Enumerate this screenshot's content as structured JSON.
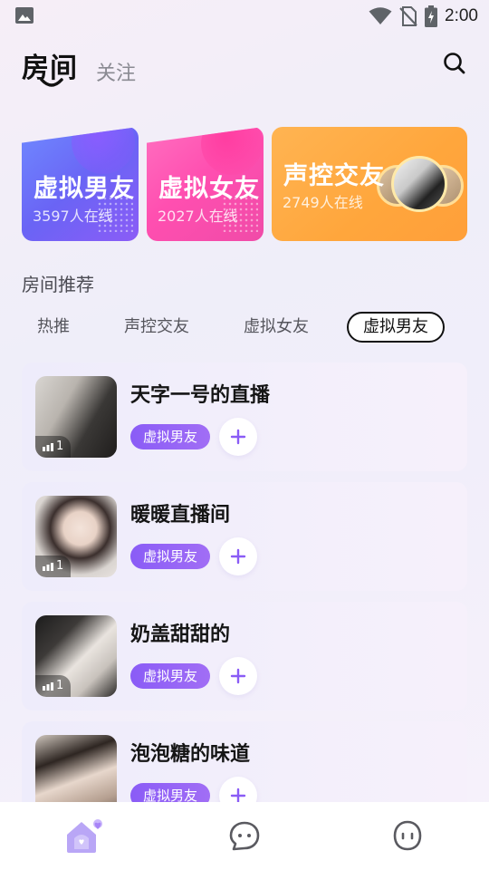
{
  "status_bar": {
    "time": "2:00",
    "icons": [
      "gallery-icon",
      "wifi-icon",
      "no-sim-icon",
      "battery-charging-icon"
    ]
  },
  "header": {
    "title": "房间",
    "follow_tab": "关注",
    "search_icon": "search-icon"
  },
  "categories": [
    {
      "name": "虚拟男友",
      "count": "3597人在线",
      "color": "#6a64f5"
    },
    {
      "name": "虚拟女友",
      "count": "2027人在线",
      "color": "#ff4fb0"
    },
    {
      "name": "声控交友",
      "count": "2749人在线",
      "color": "#ffa63c"
    }
  ],
  "section": {
    "title": "房间推荐"
  },
  "tabs": [
    {
      "label": "热推",
      "active": false
    },
    {
      "label": "声控交友",
      "active": false
    },
    {
      "label": "虚拟女友",
      "active": false
    },
    {
      "label": "虚拟男友",
      "active": true
    }
  ],
  "rooms": [
    {
      "title": "天字一号的直播",
      "tag": "虚拟男友",
      "viewers": "1"
    },
    {
      "title": "暖暖直播间",
      "tag": "虚拟男友",
      "viewers": "1"
    },
    {
      "title": "奶盖甜甜的",
      "tag": "虚拟男友",
      "viewers": "1"
    },
    {
      "title": "泡泡糖的味道",
      "tag": "虚拟男友",
      "viewers": ""
    }
  ],
  "bottom_nav": [
    {
      "icon": "house-heart-icon",
      "active": true
    },
    {
      "icon": "chat-bubble-icon",
      "active": false
    },
    {
      "icon": "face-icon",
      "active": false
    }
  ],
  "colors": {
    "accent_purple": "#8a5cf6",
    "tag_gradient_end": "#a16ef5",
    "card_blue": "#6a64f5",
    "card_pink": "#ff4fb0",
    "card_orange": "#ffa63c"
  }
}
